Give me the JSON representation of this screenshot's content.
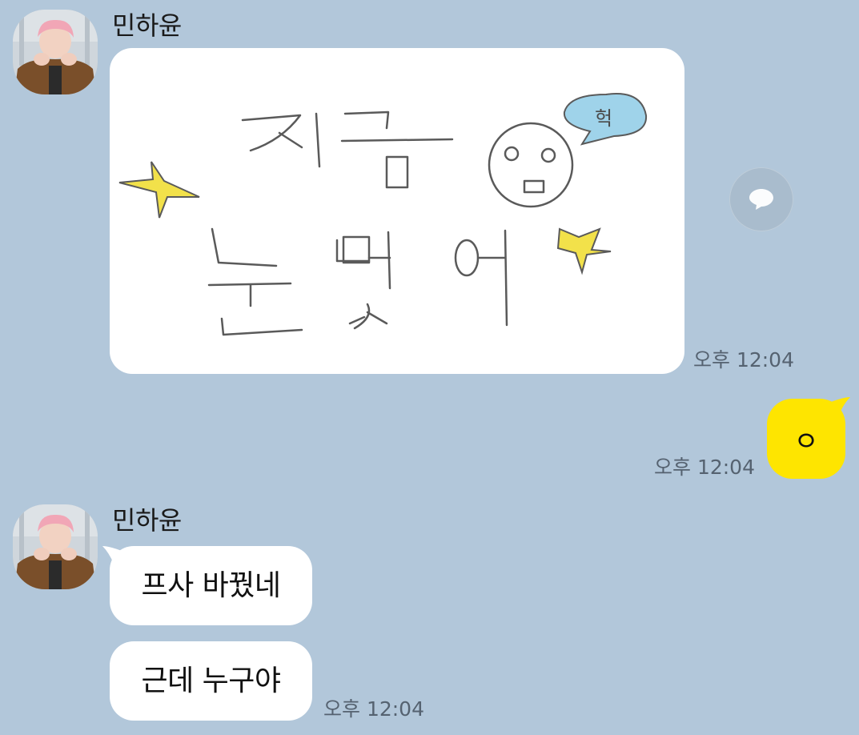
{
  "messages": [
    {
      "sender": "민하윤",
      "type": "image",
      "image_text": {
        "line1": "지금",
        "line2": "눈떴어",
        "speech": "헉"
      },
      "time": "오후 12:04"
    },
    {
      "sender": "me",
      "type": "text",
      "text": "ㅇ",
      "time": "오후 12:04"
    },
    {
      "sender": "민하윤",
      "type": "text",
      "text": "프사 바꿨네"
    },
    {
      "sender": "민하윤",
      "type": "text",
      "text": "근데 누구야",
      "time": "오후 12:04"
    }
  ],
  "icons": {
    "share": "speech-bubble-icon"
  },
  "colors": {
    "background": "#b2c7da",
    "my_bubble": "#fee500",
    "their_bubble": "#ffffff",
    "timestamp": "#556270",
    "drawing_star": "#f2e14a",
    "drawing_speech": "#9fd3ea"
  }
}
